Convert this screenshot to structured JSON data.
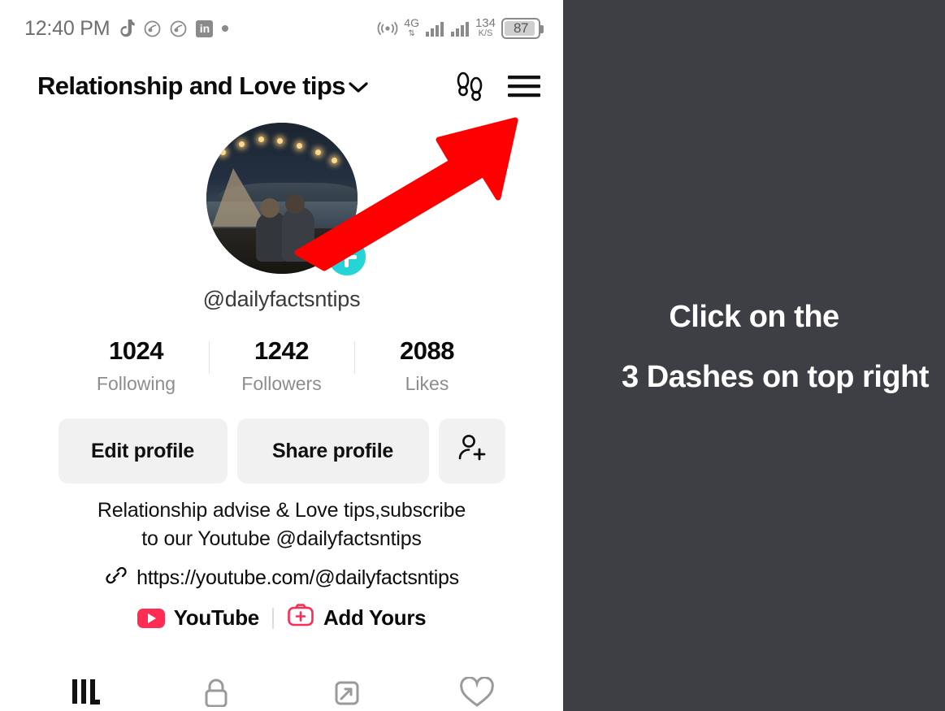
{
  "statusbar": {
    "time": "12:40 PM",
    "icons_left": [
      "tiktok-icon",
      "notification-icon",
      "notification-icon",
      "linkedin-icon",
      "dot-icon"
    ],
    "linkedin_label": "in",
    "network_type": "4G",
    "net_speed_value": "134",
    "net_speed_unit": "K/S",
    "battery_level": "87"
  },
  "header": {
    "title": "Relationship and Love tips",
    "dropdown_icon": "chevron-down-icon",
    "footprints_icon": "footprints-icon",
    "menu_icon": "hamburger-menu-icon"
  },
  "profile": {
    "avatar_alt": "couple-on-beach-at-night-avatar",
    "add_badge_icon": "plus-icon",
    "username": "@dailyfactsntips",
    "stats": [
      {
        "value": "1024",
        "label": "Following"
      },
      {
        "value": "1242",
        "label": "Followers"
      },
      {
        "value": "2088",
        "label": "Likes"
      }
    ],
    "buttons": {
      "edit": "Edit profile",
      "share": "Share profile",
      "add_friend_icon": "person-add-icon"
    },
    "bio_line1": "Relationship advise & Love tips,subscribe",
    "bio_line2": "to our Youtube @dailyfactsntips",
    "link_icon": "link-chain-icon",
    "link_url": "https://youtube.com/@dailyfactsntips",
    "chips": [
      {
        "icon": "youtube-icon",
        "label": "YouTube"
      },
      {
        "icon": "add-yours-camera-plus-icon",
        "label": "Add Yours"
      }
    ]
  },
  "tabs": [
    {
      "icon": "grid-posts-icon",
      "active": true
    },
    {
      "icon": "lock-private-icon",
      "active": false
    },
    {
      "icon": "repost-icon",
      "active": false
    },
    {
      "icon": "heart-liked-icon",
      "active": false
    }
  ],
  "annotation": {
    "arrow_icon": "red-arrow-pointing-up-right",
    "arrow_color": "#FF0000",
    "line1": "Click on the",
    "line2": "3 Dashes on top right",
    "panel_bg": "#3D3F44",
    "text_color": "#FFFFFF"
  }
}
